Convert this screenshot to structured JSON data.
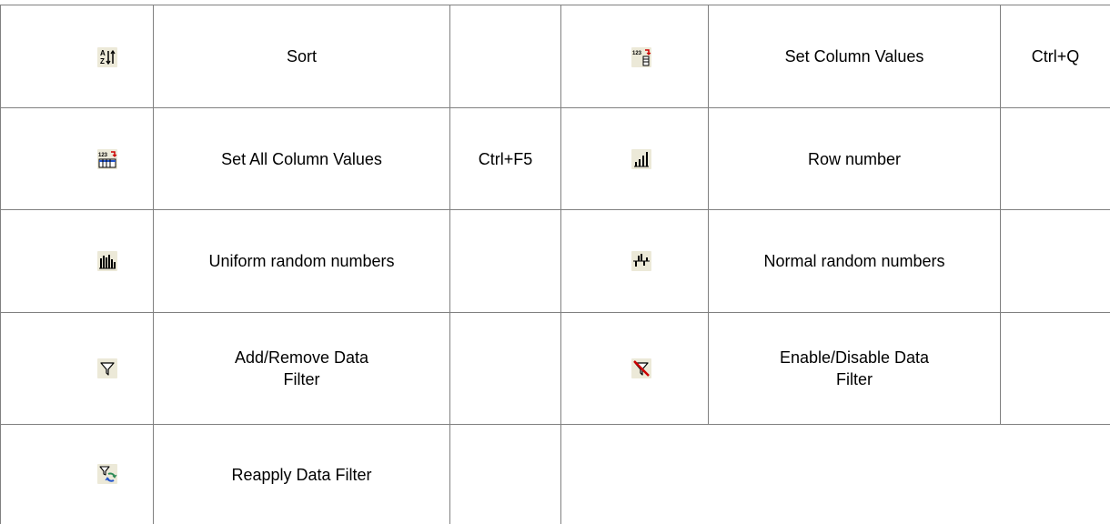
{
  "commands": [
    {
      "icon": "sort-icon",
      "label": "Sort",
      "shortcut": ""
    },
    {
      "icon": "set-column-values-icon",
      "label": "Set Column Values",
      "shortcut": "Ctrl+Q"
    },
    {
      "icon": "set-all-column-values-icon",
      "label": "Set All Column Values",
      "shortcut": "Ctrl+F5"
    },
    {
      "icon": "row-number-icon",
      "label": "Row number",
      "shortcut": ""
    },
    {
      "icon": "uniform-random-numbers-icon",
      "label": "Uniform random numbers",
      "shortcut": ""
    },
    {
      "icon": "normal-random-numbers-icon",
      "label": "Normal random numbers",
      "shortcut": ""
    },
    {
      "icon": "add-remove-data-filter-icon",
      "label": "Add/Remove Data Filter",
      "shortcut": ""
    },
    {
      "icon": "enable-disable-data-filter-icon",
      "label": "Enable/Disable Data Filter",
      "shortcut": ""
    },
    {
      "icon": "reapply-data-filter-icon",
      "label": "Reapply Data Filter",
      "shortcut": ""
    }
  ],
  "colors": {
    "grid_line": "#808080",
    "icon_background": "#ece9d8",
    "arrow_red": "#cc0000",
    "arrow_green": "#2e8b57",
    "arrow_blue": "#2255cc"
  }
}
